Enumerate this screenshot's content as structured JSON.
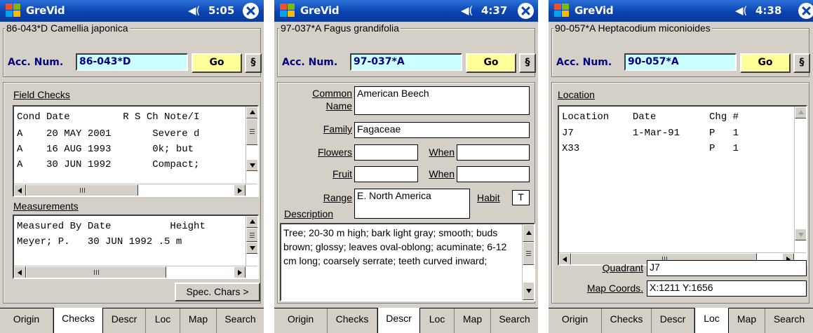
{
  "screens": [
    {
      "app_title": "GreVid",
      "clock": "5:05",
      "header_legend": "86-043*D Camellia japonica",
      "acc_label": "Acc. Num.",
      "acc_value": "86-043*D",
      "go_label": "Go",
      "section_label": "§",
      "field_checks": {
        "title": "Field Checks",
        "header": "Cond Date         R S Ch Note/I",
        "rows": [
          "A    20 MAY 2001       Severe d",
          "A    16 AUG 1993       0k; but ",
          "A    30 JUN 1992       Compact;"
        ]
      },
      "measurements": {
        "title": "Measurements",
        "header": "Measured By Date          Height",
        "rows": [
          "Meyer; P.   30 JUN 1992 .5 m"
        ]
      },
      "spec_chars_label": "Spec. Chars >",
      "tabs": [
        "Origin",
        "Checks",
        "Descr",
        "Loc",
        "Map",
        "Search"
      ],
      "active_tab": "Checks"
    },
    {
      "app_title": "GreVid",
      "clock": "4:37",
      "header_legend": "97-037*A Fagus grandifolia",
      "acc_label": "Acc. Num.",
      "acc_value": "97-037*A",
      "go_label": "Go",
      "section_label": "§",
      "common_name_label_1": "Common",
      "common_name_label_2": "Name",
      "common_name_value": "American Beech",
      "family_label": "Family",
      "family_value": "Fagaceae",
      "flowers_label": "Flowers",
      "flowers_value": "",
      "flowers_when_label": "When",
      "flowers_when_value": "",
      "fruit_label": "Fruit",
      "fruit_value": "",
      "fruit_when_label": "When",
      "fruit_when_value": "",
      "range_label": "Range",
      "range_value": "E. North America",
      "habit_label": "Habit",
      "habit_value": "T",
      "description_label": "Description",
      "description_text": "Tree; 20-30 m high; bark light gray; smooth; buds brown; glossy; leaves oval-oblong; acuminate; 6-12 cm long; coarsely serrate; teeth curved inward;",
      "tabs": [
        "Origin",
        "Checks",
        "Descr",
        "Loc",
        "Map",
        "Search"
      ],
      "active_tab": "Descr"
    },
    {
      "app_title": "GreVid",
      "clock": "4:38",
      "header_legend": "90-057*A Heptacodium miconioides",
      "acc_label": "Acc. Num.",
      "acc_value": "90-057*A",
      "go_label": "Go",
      "section_label": "§",
      "location": {
        "title": "Location",
        "header": "Location    Date         Chg #",
        "rows": [
          "J7          1-Mar-91     P   1",
          "X33                      P   1"
        ]
      },
      "quadrant_label": "Quadrant",
      "quadrant_value": "J7",
      "map_coords_label": "Map Coords.",
      "map_coords_value": "X:1211 Y:1656",
      "tabs": [
        "Origin",
        "Checks",
        "Descr",
        "Loc",
        "Map",
        "Search"
      ],
      "active_tab": "Loc"
    }
  ],
  "icons": {
    "start": "windows-flag-icon",
    "volume": "speaker-icon",
    "close": "close-icon"
  },
  "colors": {
    "titlebar": "#0a43b0",
    "acc_field": "#ccffff",
    "go_button": "#ffff99",
    "form_background": "#d4d0c8",
    "acc_text": "#000080"
  }
}
